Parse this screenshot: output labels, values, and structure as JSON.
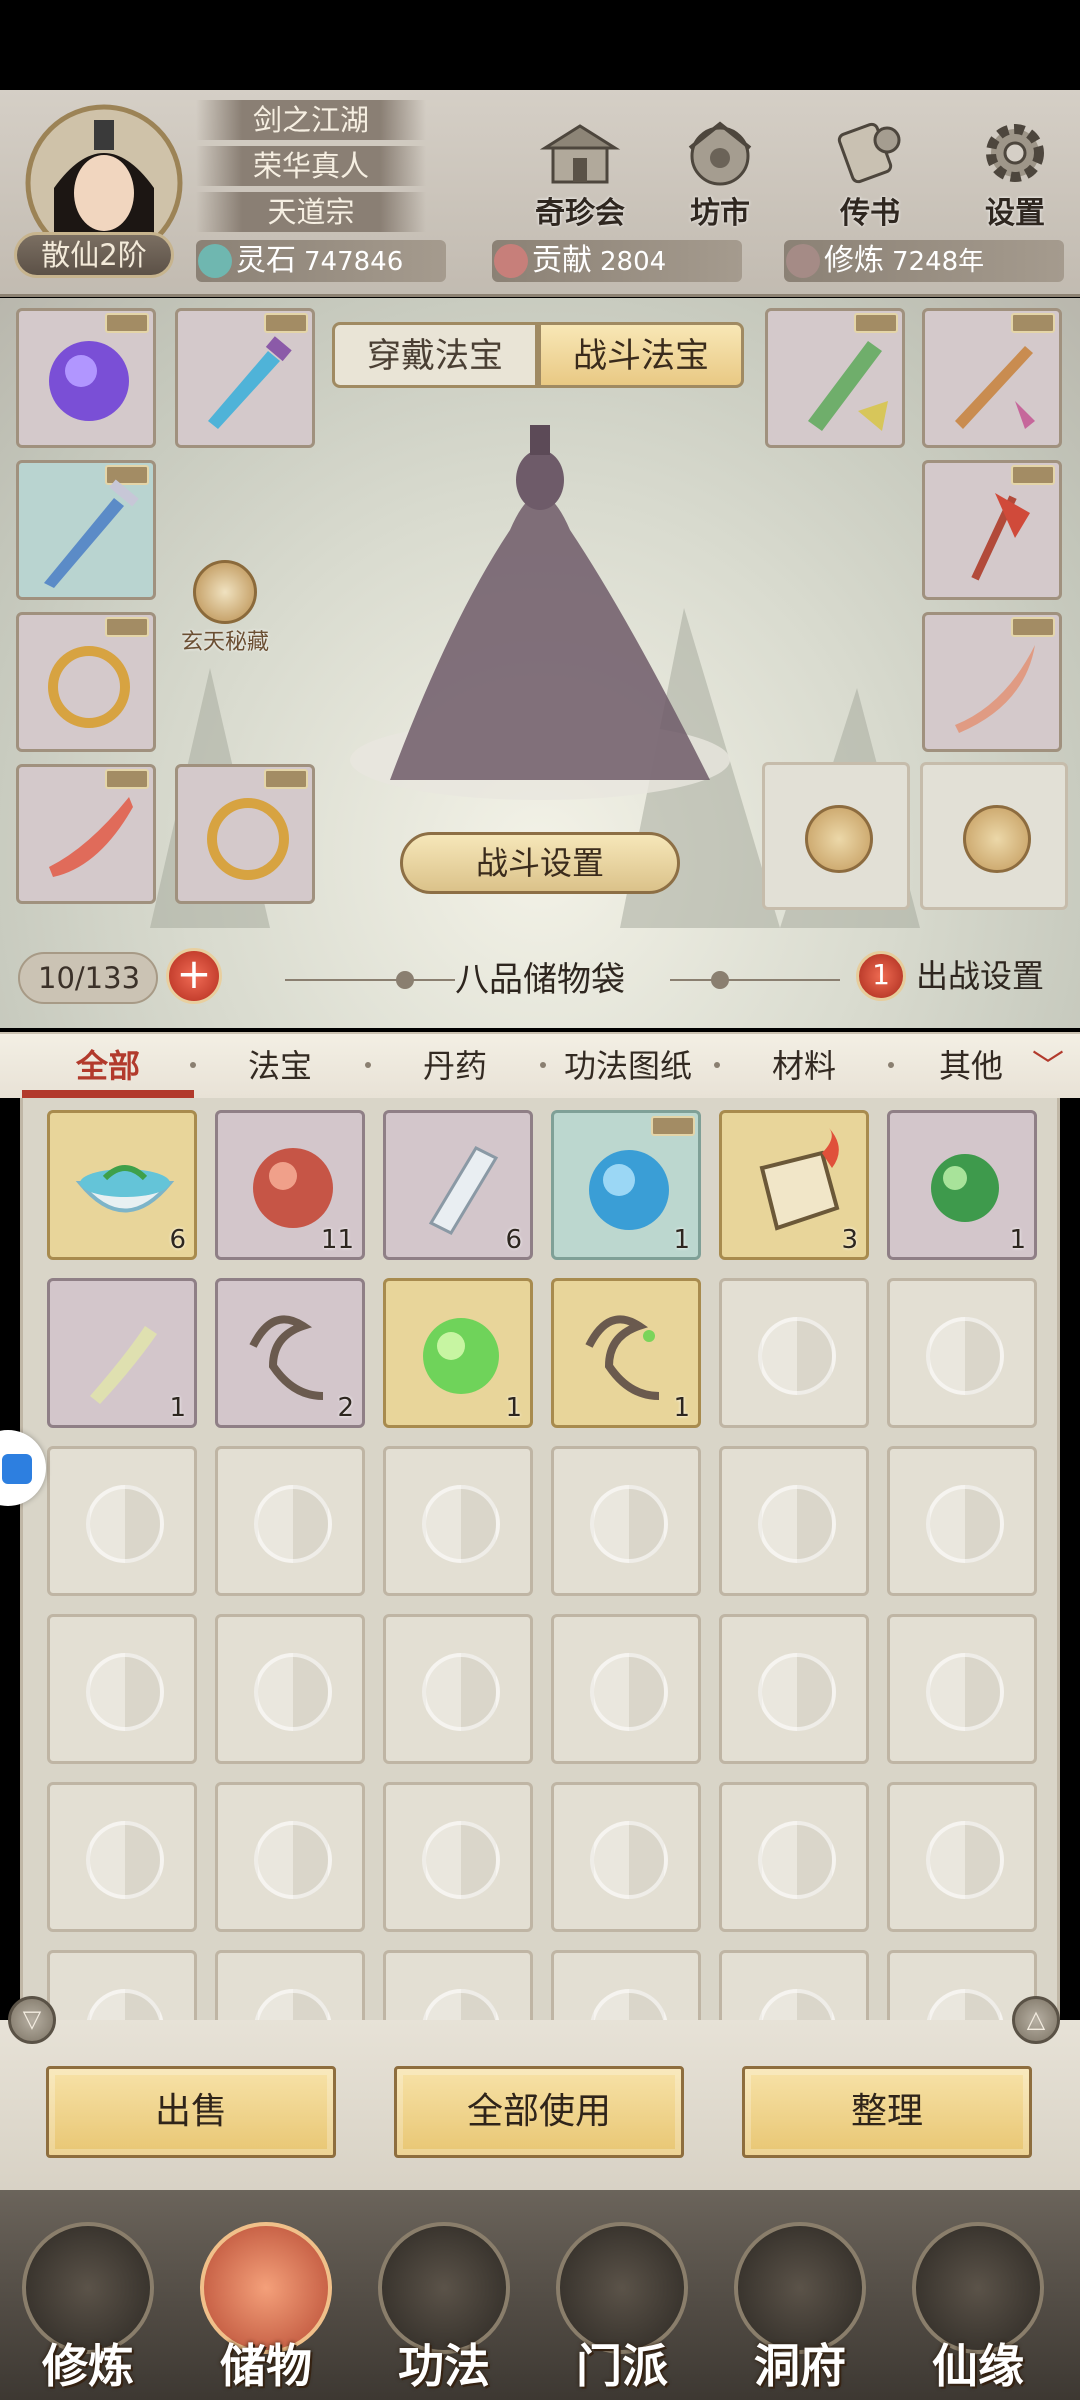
{
  "header": {
    "names": [
      "剑之江湖",
      "荣华真人",
      "天道宗"
    ],
    "rank": "散仙2阶",
    "icons": [
      {
        "label": "奇珍会",
        "icon": "treasure-pavilion-icon"
      },
      {
        "label": "坊市",
        "icon": "market-icon"
      },
      {
        "label": "传书",
        "icon": "scroll-mail-icon"
      },
      {
        "label": "设置",
        "icon": "gear-icon"
      }
    ],
    "resources": [
      {
        "label": "灵石",
        "value": "747846",
        "color": "#6fb7b0"
      },
      {
        "label": "贡献",
        "value": "2804",
        "color": "#c77f7a"
      },
      {
        "label": "修炼",
        "value": "7248年",
        "color": "#a58b86"
      }
    ]
  },
  "equipment": {
    "tabs": [
      "穿戴法宝",
      "战斗法宝"
    ],
    "active_tab": "战斗法宝",
    "xuantian": "玄天秘藏",
    "fight_settings_button": "战斗设置"
  },
  "bag": {
    "count": "10/133",
    "plus": "+",
    "title": "八品储物袋",
    "battle_badge": "1",
    "battle_setup": "出战设置"
  },
  "filters": {
    "tabs": [
      "全部",
      "法宝",
      "丹药",
      "功法图纸",
      "材料",
      "其他"
    ],
    "active": "全部",
    "expand": "﹀"
  },
  "items": [
    {
      "icon": "herb-bowl-icon",
      "count": "6",
      "rarity": "gold"
    },
    {
      "icon": "red-orb-icon",
      "count": "11",
      "rarity": "purple"
    },
    {
      "icon": "crystal-icon",
      "count": "6",
      "rarity": "purple"
    },
    {
      "icon": "blue-orb-icon",
      "count": "1",
      "rarity": "teal"
    },
    {
      "icon": "fire-talisman-icon",
      "count": "3",
      "rarity": "gold"
    },
    {
      "icon": "green-pearl-icon",
      "count": "1",
      "rarity": "purple"
    },
    {
      "icon": "bone-icon",
      "count": "1",
      "rarity": "purple"
    },
    {
      "icon": "whip-icon",
      "count": "2",
      "rarity": "purple"
    },
    {
      "icon": "green-pill-icon",
      "count": "1",
      "rarity": "gold"
    },
    {
      "icon": "vine-whip-icon",
      "count": "1",
      "rarity": "gold"
    }
  ],
  "actions": {
    "sell": "出售",
    "use_all": "全部使用",
    "sort": "整理"
  },
  "nav": [
    {
      "label": "修炼",
      "icon": "cultivation-icon"
    },
    {
      "label": "储物",
      "icon": "storage-bag-icon",
      "active": true
    },
    {
      "label": "功法",
      "icon": "manual-icon"
    },
    {
      "label": "门派",
      "icon": "sect-gate-icon"
    },
    {
      "label": "洞府",
      "icon": "cave-icon"
    },
    {
      "label": "仙缘",
      "icon": "fate-icon"
    }
  ]
}
